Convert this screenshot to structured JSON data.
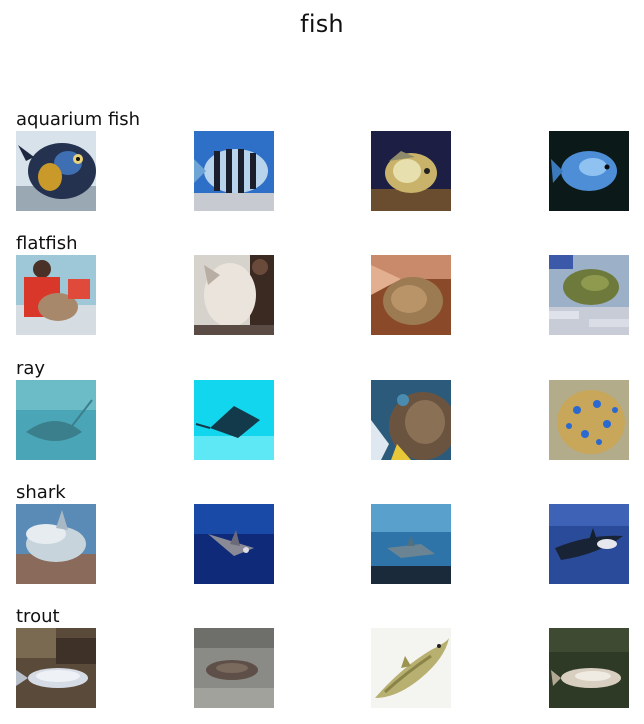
{
  "figure": {
    "title": "fish"
  },
  "rows": [
    {
      "label": "aquarium fish"
    },
    {
      "label": "flatfish"
    },
    {
      "label": "ray"
    },
    {
      "label": "shark"
    },
    {
      "label": "trout"
    }
  ],
  "images_per_row": 4
}
